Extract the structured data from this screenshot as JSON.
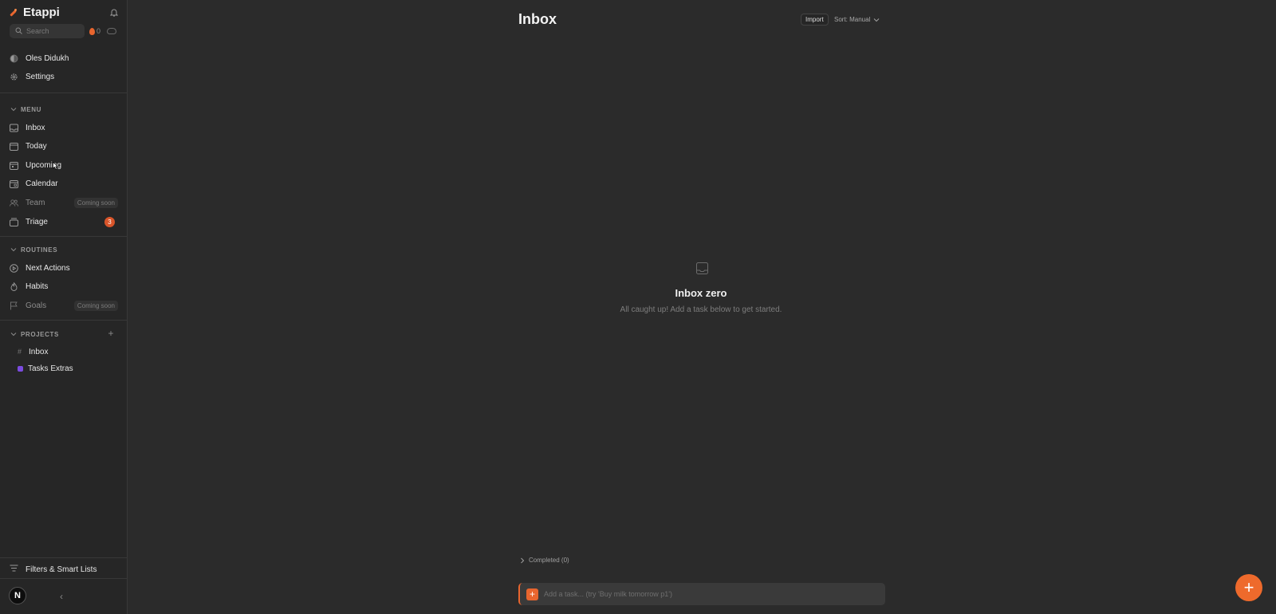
{
  "app": {
    "name": "Etappi"
  },
  "sidebar": {
    "search_placeholder": "Search",
    "streak_count": "0",
    "user": "Oles Didukh",
    "settings": "Settings",
    "menu_header": "MENU",
    "menu": [
      {
        "label": "Inbox",
        "icon": "inbox-icon"
      },
      {
        "label": "Today",
        "icon": "calendar-today-icon"
      },
      {
        "label": "Upcoming",
        "icon": "calendar-upcoming-icon"
      },
      {
        "label": "Calendar",
        "icon": "calendar-icon"
      },
      {
        "label": "Team",
        "icon": "team-icon",
        "tag": "Coming soon"
      },
      {
        "label": "Triage",
        "icon": "triage-icon",
        "badge": "3"
      }
    ],
    "routines_header": "ROUTINES",
    "routines": [
      {
        "label": "Next Actions",
        "icon": "play-circle-icon"
      },
      {
        "label": "Habits",
        "icon": "habit-flame-icon"
      },
      {
        "label": "Goals",
        "icon": "flag-icon",
        "tag": "Coming soon"
      }
    ],
    "projects_header": "PROJECTS",
    "projects": [
      {
        "label": "Inbox",
        "marker": "#"
      },
      {
        "label": "Tasks Extras",
        "color": "#7b4be0"
      }
    ],
    "filters": "Filters & Smart Lists",
    "avatar_letter": "N"
  },
  "main": {
    "title": "Inbox",
    "import": "Import",
    "sort": "Sort: Manual",
    "empty_title": "Inbox zero",
    "empty_subtitle": "All caught up! Add a task below to get started.",
    "completed": "Completed (0)",
    "add_placeholder": "Add a task... (try 'Buy milk tomorrow p1')"
  },
  "colors": {
    "accent": "#e8652e",
    "badge": "#d9552a",
    "background": "#2b2b2b",
    "sidebar": "#262626"
  }
}
